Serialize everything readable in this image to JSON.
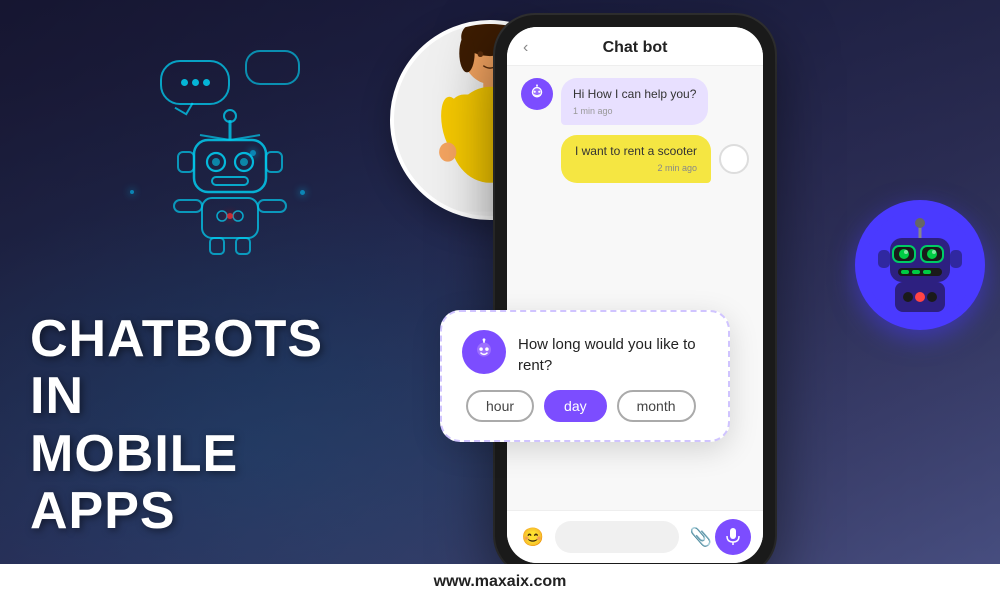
{
  "page": {
    "title": "Chatbots in Mobile Apps",
    "website": "www.maxaix.com"
  },
  "left": {
    "main_title_line1": "CHATBOTS IN",
    "main_title_line2": "MOBILE APPS"
  },
  "phone": {
    "header_title": "Chat bot",
    "back_arrow": "‹",
    "messages": [
      {
        "type": "bot",
        "text": "Hi  How I can help you?",
        "time": "1 min ago"
      },
      {
        "type": "user",
        "text": "I want to rent a scooter",
        "time": "2 min ago"
      }
    ],
    "card_question": "How long would you like to rent?",
    "options": [
      "hour",
      "day",
      "month"
    ],
    "active_option": "day"
  },
  "bottom_bar": {
    "url": "www.maxaix.com"
  },
  "icons": {
    "bot_emoji": "🤖",
    "mic_icon": "🎤",
    "emoji_icon": "😊",
    "clip_icon": "📎",
    "back_icon": "‹"
  }
}
